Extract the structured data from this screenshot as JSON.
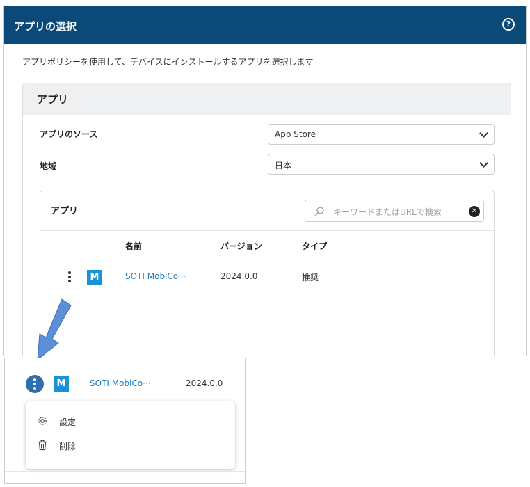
{
  "dialog": {
    "title": "アプリの選択",
    "help_icon": "?",
    "description": "アプリポリシーを使用して、デバイスにインストールするアプリを選択します"
  },
  "panel": {
    "title": "アプリ",
    "source_label": "アプリのソース",
    "source_value": "App Store",
    "region_label": "地域",
    "region_value": "日本"
  },
  "apps": {
    "title": "アプリ",
    "search_placeholder": "キーワードまたはURLで検索",
    "columns": {
      "name": "名前",
      "version": "バージョン",
      "type": "タイプ"
    },
    "rows": [
      {
        "logo": "M",
        "name": "SOTI MobiCo···",
        "version": "2024.0.0",
        "type": "推奨"
      }
    ]
  },
  "inset": {
    "row": {
      "logo": "M",
      "name": "SOTI MobiCo···",
      "version": "2024.0.0"
    },
    "menu": [
      {
        "label": "設定",
        "icon": "gear-icon"
      },
      {
        "label": "削除",
        "icon": "trash-icon"
      }
    ]
  },
  "colors": {
    "header": "#0b4a78",
    "link": "#1e7cc0",
    "app_logo": "#1b91d6",
    "arrow": "#5b8fd9"
  }
}
